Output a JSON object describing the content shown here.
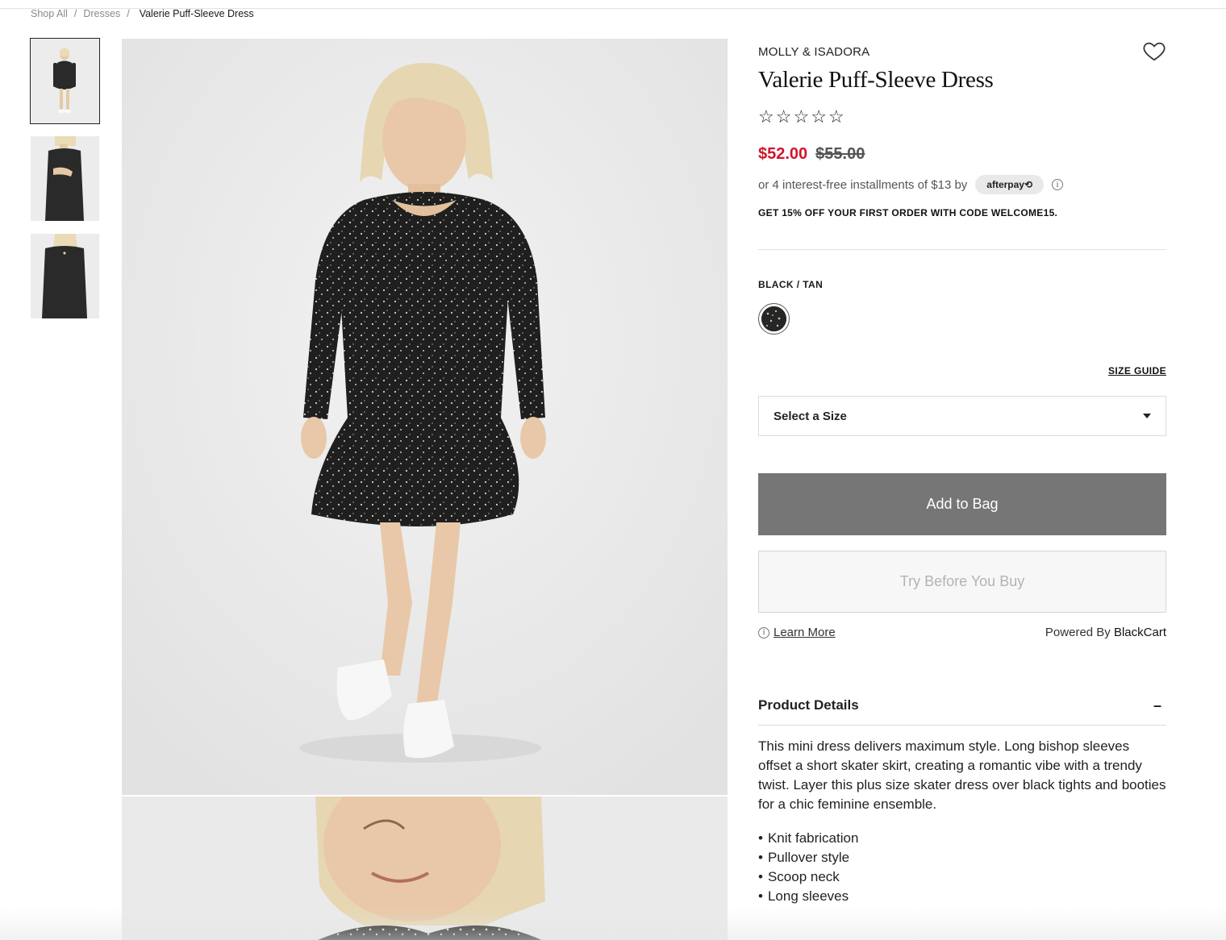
{
  "breadcrumb": {
    "items": [
      "Shop All",
      "Dresses"
    ],
    "separator": "/",
    "current": "Valerie Puff-Sleeve Dress"
  },
  "product": {
    "brand": "MOLLY & ISADORA",
    "title": "Valerie Puff-Sleeve Dress",
    "rating_stars": 0,
    "price_sale": "$52.00",
    "price_original": "$55.00",
    "installments_text": "or 4 interest-free installments of $13 by",
    "afterpay_label": "afterpay⟲",
    "promo": "GET 15% OFF YOUR FIRST ORDER WITH CODE WELCOME15.",
    "color_label": "BLACK / TAN",
    "size_guide": "SIZE GUIDE",
    "size_select": "Select a Size",
    "add_to_bag": "Add to Bag",
    "try_before": "Try Before You Buy",
    "learn_more": "Learn More",
    "powered_by": "Powered By",
    "powered_brand": "BlackCart",
    "details_title": "Product Details",
    "details_toggle": "–",
    "description": "This mini dress delivers maximum style. Long bishop sleeves offset a short skater skirt, creating a romantic vibe with a trendy twist. Layer this plus size skater dress over black tights and booties for a chic feminine ensemble.",
    "bullets": [
      "Knit fabrication",
      "Pullover style",
      "Scoop neck",
      "Long sleeves"
    ]
  },
  "colors": {
    "sale_price": "#d0162b",
    "add_to_bag_bg": "#767676",
    "dress": "#1f1f1f"
  },
  "icons": {
    "heart": "heart-icon",
    "star": "star-outline-icon",
    "info": "info-icon",
    "caret": "caret-down-icon"
  }
}
